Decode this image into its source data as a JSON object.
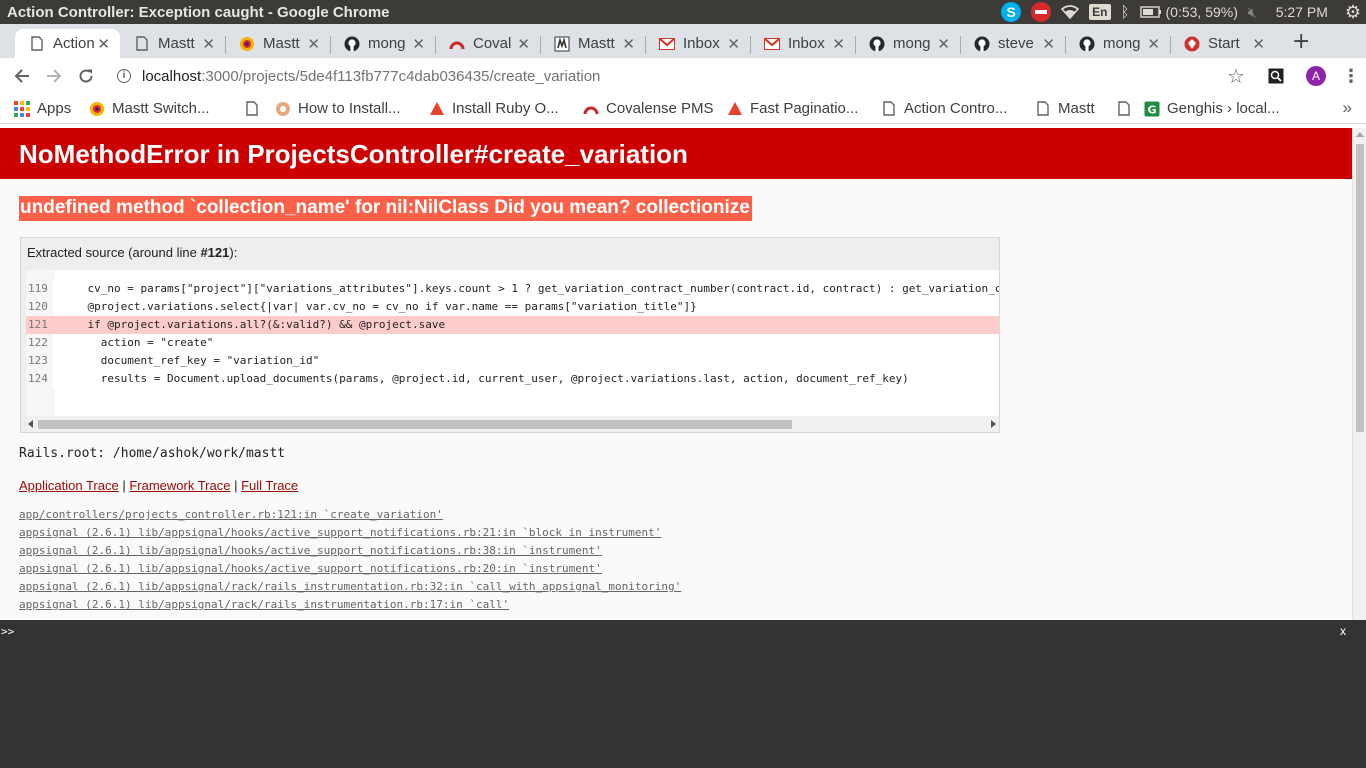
{
  "os": {
    "window_title": "Action Controller: Exception caught - Google Chrome",
    "battery": "(0:53, 59%)",
    "keyboard": "En",
    "clock": "5:27 PM"
  },
  "tabs": [
    {
      "title": "Action",
      "favicon": "document-icon",
      "active": true
    },
    {
      "title": "Mastt",
      "favicon": "document-icon",
      "active": false
    },
    {
      "title": "Mastt",
      "favicon": "appsignal-icon",
      "active": false
    },
    {
      "title": "mong",
      "favicon": "github-icon",
      "active": false
    },
    {
      "title": "Coval",
      "favicon": "covalense-icon",
      "active": false
    },
    {
      "title": "Mastt",
      "favicon": "mastt-icon",
      "active": false
    },
    {
      "title": "Inbox",
      "favicon": "gmail-icon",
      "active": false
    },
    {
      "title": "Inbox",
      "favicon": "gmail-icon",
      "active": false
    },
    {
      "title": "mong",
      "favicon": "github-icon",
      "active": false
    },
    {
      "title": "steve",
      "favicon": "github-icon",
      "active": false
    },
    {
      "title": "mong",
      "favicon": "github-icon",
      "active": false
    },
    {
      "title": "Start",
      "favicon": "ruby-icon",
      "active": false
    }
  ],
  "toolbar": {
    "url_host": "localhost",
    "url_rest": ":3000/projects/5de4f113fb777c4dab036435/create_variation",
    "avatar_letter": "A"
  },
  "bookmarks": [
    {
      "label": "Apps",
      "icon": "apps-grid-icon"
    },
    {
      "label": "Mastt Switch...",
      "icon": "appsignal-icon"
    },
    {
      "label": "",
      "icon": "document-icon"
    },
    {
      "label": "How to Install...",
      "icon": "globe-icon"
    },
    {
      "label": "Install Ruby O...",
      "icon": "warning-icon"
    },
    {
      "label": "Covalense PMS",
      "icon": "covalense-icon"
    },
    {
      "label": "Fast Paginatio...",
      "icon": "warning-icon"
    },
    {
      "label": "Action Contro...",
      "icon": "document-icon"
    },
    {
      "label": "Mastt",
      "icon": "document-icon"
    },
    {
      "label": "",
      "icon": "document-icon"
    },
    {
      "label": "Genghis › local...",
      "icon": "genghis-icon"
    }
  ],
  "page": {
    "error_title": "NoMethodError in ProjectsController#create_variation",
    "error_message": "undefined method `collection_name' for nil:NilClass Did you mean? collectionize",
    "source_head_prefix": "Extracted source (around line ",
    "source_head_line": "#121",
    "source_head_suffix": "):",
    "code_lines": [
      {
        "num": "119",
        "text": "    cv_no = params[\"project\"][\"variations_attributes\"].keys.count > 1 ? get_variation_contract_number(contract.id, contract) : get_variation_c",
        "highlight": false
      },
      {
        "num": "120",
        "text": "    @project.variations.select{|var| var.cv_no = cv_no if var.name == params[\"variation_title\"]}",
        "highlight": false
      },
      {
        "num": "121",
        "text": "    if @project.variations.all?(&:valid?) && @project.save",
        "highlight": true
      },
      {
        "num": "122",
        "text": "      action = \"create\"",
        "highlight": false
      },
      {
        "num": "123",
        "text": "      document_ref_key = \"variation_id\"",
        "highlight": false
      },
      {
        "num": "124",
        "text": "      results = Document.upload_documents(params, @project.id, current_user, @project.variations.last, action, document_ref_key)",
        "highlight": false
      }
    ],
    "rails_root": "Rails.root: /home/ashok/work/mastt",
    "trace_links": [
      "Application Trace",
      "Framework Trace",
      "Full Trace"
    ],
    "trace_sep": " | ",
    "trace_items": [
      "app/controllers/projects_controller.rb:121:in `create_variation'",
      "appsignal (2.6.1) lib/appsignal/hooks/active_support_notifications.rb:21:in `block in instrument'",
      "appsignal (2.6.1) lib/appsignal/hooks/active_support_notifications.rb:38:in `instrument'",
      "appsignal (2.6.1) lib/appsignal/hooks/active_support_notifications.rb:20:in `instrument'",
      "appsignal (2.6.1) lib/appsignal/rack/rails_instrumentation.rb:32:in `call_with_appsignal_monitoring'",
      "appsignal (2.6.1) lib/appsignal/rack/rails_instrumentation.rb:17:in `call'"
    ]
  },
  "console": {
    "prompt": ">>",
    "close_label": "x"
  },
  "colors": {
    "error_header": "#cc0000",
    "error_message_bg": "#fa6148",
    "highlight_row": "#ffcccc",
    "trace_link": "#980905"
  }
}
